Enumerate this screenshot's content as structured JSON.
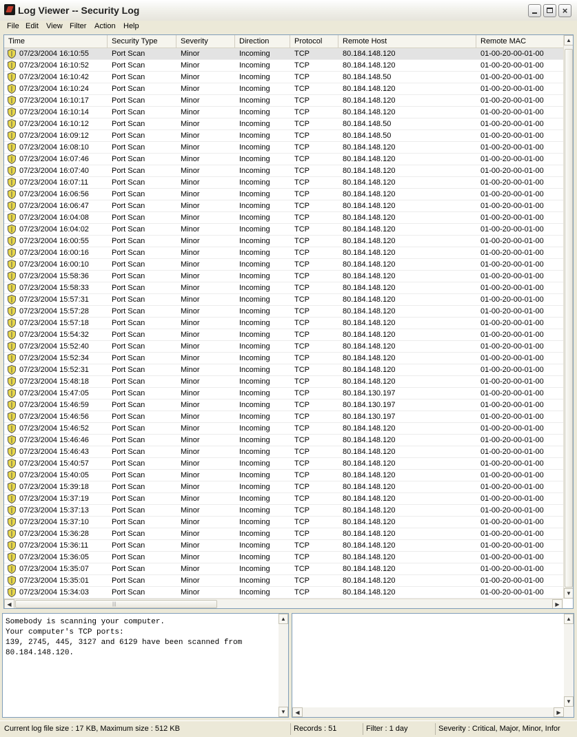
{
  "window": {
    "title": "Log Viewer -- Security Log",
    "close_glyph": "×"
  },
  "menu": [
    "File",
    "Edit",
    "View",
    "Filter",
    "Action",
    "Help"
  ],
  "columns": [
    "Time",
    "Security Type",
    "Severity",
    "Direction",
    "Protocol",
    "Remote Host",
    "Remote MAC"
  ],
  "rows": [
    [
      "07/23/2004 16:10:55",
      "Port Scan",
      "Minor",
      "Incoming",
      "TCP",
      "80.184.148.120",
      "01-00-20-00-01-00"
    ],
    [
      "07/23/2004 16:10:52",
      "Port Scan",
      "Minor",
      "Incoming",
      "TCP",
      "80.184.148.120",
      "01-00-20-00-01-00"
    ],
    [
      "07/23/2004 16:10:42",
      "Port Scan",
      "Minor",
      "Incoming",
      "TCP",
      "80.184.148.50",
      "01-00-20-00-01-00"
    ],
    [
      "07/23/2004 16:10:24",
      "Port Scan",
      "Minor",
      "Incoming",
      "TCP",
      "80.184.148.120",
      "01-00-20-00-01-00"
    ],
    [
      "07/23/2004 16:10:17",
      "Port Scan",
      "Minor",
      "Incoming",
      "TCP",
      "80.184.148.120",
      "01-00-20-00-01-00"
    ],
    [
      "07/23/2004 16:10:14",
      "Port Scan",
      "Minor",
      "Incoming",
      "TCP",
      "80.184.148.120",
      "01-00-20-00-01-00"
    ],
    [
      "07/23/2004 16:10:12",
      "Port Scan",
      "Minor",
      "Incoming",
      "TCP",
      "80.184.148.50",
      "01-00-20-00-01-00"
    ],
    [
      "07/23/2004 16:09:12",
      "Port Scan",
      "Minor",
      "Incoming",
      "TCP",
      "80.184.148.50",
      "01-00-20-00-01-00"
    ],
    [
      "07/23/2004 16:08:10",
      "Port Scan",
      "Minor",
      "Incoming",
      "TCP",
      "80.184.148.120",
      "01-00-20-00-01-00"
    ],
    [
      "07/23/2004 16:07:46",
      "Port Scan",
      "Minor",
      "Incoming",
      "TCP",
      "80.184.148.120",
      "01-00-20-00-01-00"
    ],
    [
      "07/23/2004 16:07:40",
      "Port Scan",
      "Minor",
      "Incoming",
      "TCP",
      "80.184.148.120",
      "01-00-20-00-01-00"
    ],
    [
      "07/23/2004 16:07:11",
      "Port Scan",
      "Minor",
      "Incoming",
      "TCP",
      "80.184.148.120",
      "01-00-20-00-01-00"
    ],
    [
      "07/23/2004 16:06:56",
      "Port Scan",
      "Minor",
      "Incoming",
      "TCP",
      "80.184.148.120",
      "01-00-20-00-01-00"
    ],
    [
      "07/23/2004 16:06:47",
      "Port Scan",
      "Minor",
      "Incoming",
      "TCP",
      "80.184.148.120",
      "01-00-20-00-01-00"
    ],
    [
      "07/23/2004 16:04:08",
      "Port Scan",
      "Minor",
      "Incoming",
      "TCP",
      "80.184.148.120",
      "01-00-20-00-01-00"
    ],
    [
      "07/23/2004 16:04:02",
      "Port Scan",
      "Minor",
      "Incoming",
      "TCP",
      "80.184.148.120",
      "01-00-20-00-01-00"
    ],
    [
      "07/23/2004 16:00:55",
      "Port Scan",
      "Minor",
      "Incoming",
      "TCP",
      "80.184.148.120",
      "01-00-20-00-01-00"
    ],
    [
      "07/23/2004 16:00:16",
      "Port Scan",
      "Minor",
      "Incoming",
      "TCP",
      "80.184.148.120",
      "01-00-20-00-01-00"
    ],
    [
      "07/23/2004 16:00:10",
      "Port Scan",
      "Minor",
      "Incoming",
      "TCP",
      "80.184.148.120",
      "01-00-20-00-01-00"
    ],
    [
      "07/23/2004 15:58:36",
      "Port Scan",
      "Minor",
      "Incoming",
      "TCP",
      "80.184.148.120",
      "01-00-20-00-01-00"
    ],
    [
      "07/23/2004 15:58:33",
      "Port Scan",
      "Minor",
      "Incoming",
      "TCP",
      "80.184.148.120",
      "01-00-20-00-01-00"
    ],
    [
      "07/23/2004 15:57:31",
      "Port Scan",
      "Minor",
      "Incoming",
      "TCP",
      "80.184.148.120",
      "01-00-20-00-01-00"
    ],
    [
      "07/23/2004 15:57:28",
      "Port Scan",
      "Minor",
      "Incoming",
      "TCP",
      "80.184.148.120",
      "01-00-20-00-01-00"
    ],
    [
      "07/23/2004 15:57:18",
      "Port Scan",
      "Minor",
      "Incoming",
      "TCP",
      "80.184.148.120",
      "01-00-20-00-01-00"
    ],
    [
      "07/23/2004 15:54:32",
      "Port Scan",
      "Minor",
      "Incoming",
      "TCP",
      "80.184.148.120",
      "01-00-20-00-01-00"
    ],
    [
      "07/23/2004 15:52:40",
      "Port Scan",
      "Minor",
      "Incoming",
      "TCP",
      "80.184.148.120",
      "01-00-20-00-01-00"
    ],
    [
      "07/23/2004 15:52:34",
      "Port Scan",
      "Minor",
      "Incoming",
      "TCP",
      "80.184.148.120",
      "01-00-20-00-01-00"
    ],
    [
      "07/23/2004 15:52:31",
      "Port Scan",
      "Minor",
      "Incoming",
      "TCP",
      "80.184.148.120",
      "01-00-20-00-01-00"
    ],
    [
      "07/23/2004 15:48:18",
      "Port Scan",
      "Minor",
      "Incoming",
      "TCP",
      "80.184.148.120",
      "01-00-20-00-01-00"
    ],
    [
      "07/23/2004 15:47:05",
      "Port Scan",
      "Minor",
      "Incoming",
      "TCP",
      "80.184.130.197",
      "01-00-20-00-01-00"
    ],
    [
      "07/23/2004 15:46:59",
      "Port Scan",
      "Minor",
      "Incoming",
      "TCP",
      "80.184.130.197",
      "01-00-20-00-01-00"
    ],
    [
      "07/23/2004 15:46:56",
      "Port Scan",
      "Minor",
      "Incoming",
      "TCP",
      "80.184.130.197",
      "01-00-20-00-01-00"
    ],
    [
      "07/23/2004 15:46:52",
      "Port Scan",
      "Minor",
      "Incoming",
      "TCP",
      "80.184.148.120",
      "01-00-20-00-01-00"
    ],
    [
      "07/23/2004 15:46:46",
      "Port Scan",
      "Minor",
      "Incoming",
      "TCP",
      "80.184.148.120",
      "01-00-20-00-01-00"
    ],
    [
      "07/23/2004 15:46:43",
      "Port Scan",
      "Minor",
      "Incoming",
      "TCP",
      "80.184.148.120",
      "01-00-20-00-01-00"
    ],
    [
      "07/23/2004 15:40:57",
      "Port Scan",
      "Minor",
      "Incoming",
      "TCP",
      "80.184.148.120",
      "01-00-20-00-01-00"
    ],
    [
      "07/23/2004 15:40:05",
      "Port Scan",
      "Minor",
      "Incoming",
      "TCP",
      "80.184.148.120",
      "01-00-20-00-01-00"
    ],
    [
      "07/23/2004 15:39:18",
      "Port Scan",
      "Minor",
      "Incoming",
      "TCP",
      "80.184.148.120",
      "01-00-20-00-01-00"
    ],
    [
      "07/23/2004 15:37:19",
      "Port Scan",
      "Minor",
      "Incoming",
      "TCP",
      "80.184.148.120",
      "01-00-20-00-01-00"
    ],
    [
      "07/23/2004 15:37:13",
      "Port Scan",
      "Minor",
      "Incoming",
      "TCP",
      "80.184.148.120",
      "01-00-20-00-01-00"
    ],
    [
      "07/23/2004 15:37:10",
      "Port Scan",
      "Minor",
      "Incoming",
      "TCP",
      "80.184.148.120",
      "01-00-20-00-01-00"
    ],
    [
      "07/23/2004 15:36:28",
      "Port Scan",
      "Minor",
      "Incoming",
      "TCP",
      "80.184.148.120",
      "01-00-20-00-01-00"
    ],
    [
      "07/23/2004 15:36:11",
      "Port Scan",
      "Minor",
      "Incoming",
      "TCP",
      "80.184.148.120",
      "01-00-20-00-01-00"
    ],
    [
      "07/23/2004 15:36:05",
      "Port Scan",
      "Minor",
      "Incoming",
      "TCP",
      "80.184.148.120",
      "01-00-20-00-01-00"
    ],
    [
      "07/23/2004 15:35:07",
      "Port Scan",
      "Minor",
      "Incoming",
      "TCP",
      "80.184.148.120",
      "01-00-20-00-01-00"
    ],
    [
      "07/23/2004 15:35:01",
      "Port Scan",
      "Minor",
      "Incoming",
      "TCP",
      "80.184.148.120",
      "01-00-20-00-01-00"
    ],
    [
      "07/23/2004 15:34:03",
      "Port Scan",
      "Minor",
      "Incoming",
      "TCP",
      "80.184.148.120",
      "01-00-20-00-01-00"
    ]
  ],
  "row_icon": "shield-icon",
  "detail_text": "Somebody is scanning your computer.\nYour computer's TCP ports:\n139, 2745, 445, 3127 and 6129 have been scanned from\n80.184.148.120.",
  "scroll_glyphs": {
    "up": "▲",
    "down": "▼",
    "left": "◀",
    "right": "▶",
    "grip": "|||"
  },
  "status": {
    "log_size": "Current log file size : 17 KB, Maximum size : 512 KB",
    "records": "Records : 51",
    "filter": "Filter : 1 day",
    "severity": "Severity : Critical, Major, Minor, Infor"
  },
  "colors": {
    "selected_row": "#e3e3e3",
    "shield_fill": "#e8d84a",
    "shield_stroke": "#555555"
  }
}
